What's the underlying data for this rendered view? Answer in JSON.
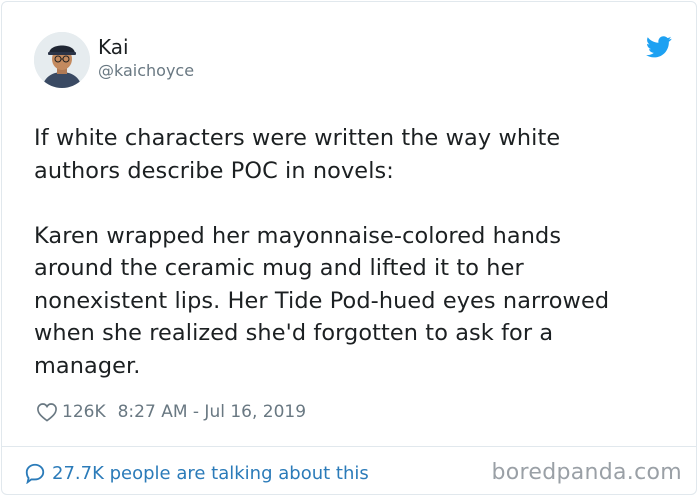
{
  "tweet": {
    "display_name": "Kai",
    "handle": "@kaichoyce",
    "paragraph_1": "If white characters were written the way white\nauthors describe POC in novels:",
    "paragraph_2": "Karen wrapped her mayonnaise-colored hands\naround the ceramic mug and lifted it to her\nnonexistent lips. Her Tide Pod-hued eyes narrowed\nwhen she realized she'd forgotten to ask for a\nmanager.",
    "likes": "126K",
    "timestamp": "8:27 AM - Jul 16, 2019"
  },
  "footer": {
    "conversation_text": "27.7K people are talking about this"
  },
  "watermark": "boredpanda.com",
  "icons": {
    "brand": "twitter-bird-icon",
    "like": "heart-icon",
    "conversation": "speech-bubble-icon"
  },
  "colors": {
    "twitter_blue": "#1da1f2",
    "link_blue": "#2b7bb9",
    "secondary_text": "#697882",
    "primary_text": "#1c2022",
    "border": "#e1e8ed"
  }
}
